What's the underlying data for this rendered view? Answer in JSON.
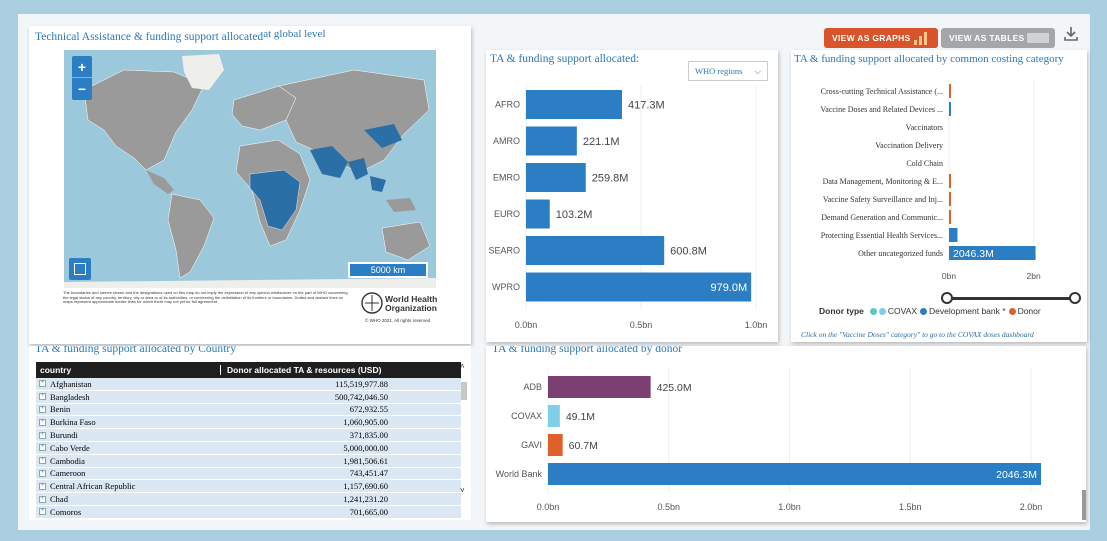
{
  "buttons": {
    "graphs": "VIEW AS GRAPHS",
    "tables": "VIEW AS TABLES"
  },
  "map": {
    "title_main": "Technical Assistance & funding support allocated",
    "title_suffix": "at global level",
    "zoom_in": "+",
    "zoom_out": "−",
    "scale": "5000 km",
    "disclaimer": "The boundaries and names shown and the designations used on this map do not imply the expression of any opinion whatsoever on the part of WHO concerning the legal status of any country, territory, city or area or of its authorities, or concerning the delimitation of its frontiers or boundaries. Dotted and dashed lines on maps represent approximate border lines for which there may not yet be full agreement.",
    "logo_text_1": "World Health",
    "logo_text_2": "Organization",
    "copyright": "© WHO 2021. All rights reserved"
  },
  "regions_chart": {
    "title": "TA & funding support allocated:",
    "dropdown": "WHO regions",
    "chart_data": {
      "type": "bar",
      "categories": [
        "AFRO",
        "AMRO",
        "EMRO",
        "EURO",
        "SEARO",
        "WPRO"
      ],
      "values": [
        417.3,
        221.1,
        259.8,
        103.2,
        600.8,
        979.0
      ],
      "labels": [
        "417.3M",
        "221.1M",
        "259.8M",
        "103.2M",
        "600.8M",
        "979.0M"
      ],
      "xticks": [
        "0.0bn",
        "0.5bn",
        "1.0bn"
      ],
      "xlim": [
        0,
        1000
      ],
      "unit": "M"
    }
  },
  "costing_chart": {
    "title": "TA & funding support allocated by common costing category",
    "chart_data": {
      "type": "bar",
      "categories": [
        "Cross-cutting Technical Assistance (...",
        "Vaccine Doses and Related Devices ...",
        "Vaccinators",
        "Vaccination Delivery",
        "Cold Chain",
        "Data Management, Monitoring & E...",
        "Vaccine Safety Surveillance and Inj...",
        "Demand Generation and Communic...",
        "Protecting Essential Health Services...",
        "Other uncategorized funds"
      ],
      "series": [
        {
          "name": "COVAX",
          "values": [
            0,
            0,
            0,
            0,
            0,
            0,
            0,
            0,
            0,
            0
          ]
        },
        {
          "name": "Development bank *",
          "values": [
            0,
            15,
            0,
            0,
            0,
            0,
            0,
            0,
            200,
            2046.3
          ]
        },
        {
          "name": "Donor",
          "values": [
            10,
            0,
            0,
            0,
            0,
            10,
            5,
            5,
            0,
            0
          ]
        }
      ],
      "labels": {
        "Other uncategorized funds": "2046.3M"
      },
      "xticks": [
        "0bn",
        "2bn"
      ],
      "xlim": [
        0,
        2600
      ]
    },
    "legend_title": "Donor type",
    "legend": [
      {
        "name": "COVAX",
        "color": "#5dc8c0"
      },
      {
        "name": "Development bank *",
        "color": "#2b7ec4"
      },
      {
        "name": "Donor",
        "color": "#e0602c"
      }
    ],
    "footnote": "Click on the \"Vaccine Doses\" category\" to go to the COVAX doses dashboard"
  },
  "country_table": {
    "title": "TA & funding support allocated by Country",
    "columns": [
      "country",
      "Donor allocated TA & resources (USD)"
    ],
    "rows": [
      [
        "Afghanistan",
        "115,519,977.88"
      ],
      [
        "Bangladesh",
        "500,742,046.50"
      ],
      [
        "Benin",
        "672,932.55"
      ],
      [
        "Burkina Faso",
        "1,060,905.00"
      ],
      [
        "Burundi",
        "371,835.00"
      ],
      [
        "Cabo Verde",
        "5,000,000.00"
      ],
      [
        "Cambodia",
        "1,981,506.61"
      ],
      [
        "Cameroon",
        "743,451.47"
      ],
      [
        "Central African Republic",
        "1,157,690.60"
      ],
      [
        "Chad",
        "1,241,231.20"
      ],
      [
        "Comoros",
        "701,665.00"
      ]
    ]
  },
  "donor_chart": {
    "title": "TA & funding support allocated by donor",
    "chart_data": {
      "type": "bar",
      "categories": [
        "ADB",
        "COVAX",
        "GAVI",
        "World Bank"
      ],
      "values": [
        425.0,
        49.1,
        60.7,
        2046.3
      ],
      "labels": [
        "425.0M",
        "49.1M",
        "60.7M",
        "2046.3M"
      ],
      "colors": [
        "#7b3f72",
        "#7dd0e8",
        "#e0602c",
        "#2b7ec4"
      ],
      "xticks": [
        "0.0bn",
        "0.5bn",
        "1.0bn",
        "1.5bn",
        "2.0bn"
      ],
      "xlim": [
        0,
        2000
      ]
    }
  }
}
